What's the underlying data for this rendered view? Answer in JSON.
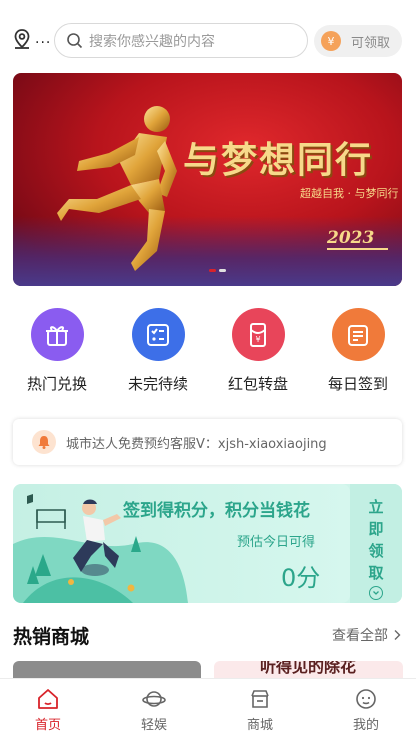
{
  "header": {
    "location_label": "...",
    "search_placeholder": "搜索你感兴趣的内容",
    "claim_coin": "¥",
    "claim_label": "可领取"
  },
  "banner": {
    "title": "与梦想同行",
    "subtitle": "超越自我 · 与梦同行",
    "year": "2023",
    "page_count": 2,
    "active_page": 1
  },
  "quick_actions": [
    {
      "label": "热门兑换",
      "icon": "gift-icon",
      "color": "#8a5cf0"
    },
    {
      "label": "未完待续",
      "icon": "checklist-icon",
      "color": "#3d6fe8"
    },
    {
      "label": "红包转盘",
      "icon": "red-envelope-icon",
      "color": "#e8455a"
    },
    {
      "label": "每日签到",
      "icon": "document-icon",
      "color": "#f07a3a"
    }
  ],
  "notice": {
    "icon": "bell-icon",
    "text": "城市达人免费预约客服V：xjsh-xiaoxiaojing"
  },
  "signin": {
    "title": "签到得积分，积分当钱花",
    "estimate_label": "预估今日可得",
    "points": "0分",
    "action": "立即领取"
  },
  "hot_sale": {
    "title": "热销商城",
    "more": "查看全部",
    "product2_text": "听得见的除花"
  },
  "tabbar": [
    {
      "label": "首页",
      "icon": "home-icon",
      "active": true
    },
    {
      "label": "轻娱",
      "icon": "planet-icon",
      "active": false
    },
    {
      "label": "商城",
      "icon": "store-icon",
      "active": false
    },
    {
      "label": "我的",
      "icon": "profile-icon",
      "active": false
    }
  ],
  "colors": {
    "brand_red": "#d8232a",
    "teal": "#2ca58b"
  }
}
